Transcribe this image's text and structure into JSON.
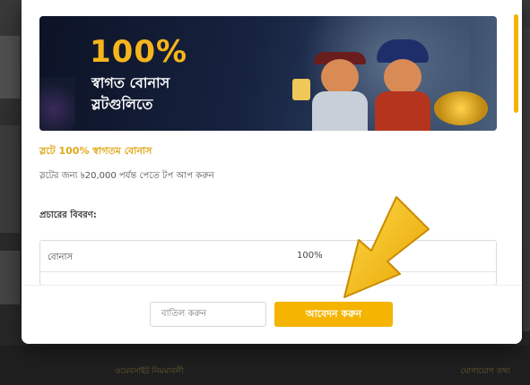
{
  "banner": {
    "headline": "100%",
    "line1": "স্বাগত বোনাস",
    "line2": "স্লটগুলিতে"
  },
  "offer": {
    "title": "স্লটে 100% স্বাগতম বোনাস",
    "description": "স্লটের জন্য ৳20,000 পর্যন্ত পেতে টপ আপ করুন"
  },
  "details_label": "প্রচারের বিবরণ:",
  "details_table": {
    "rows": [
      {
        "label": "বোনাস",
        "value": "100%"
      }
    ]
  },
  "actions": {
    "cancel_label": "বাতিল করুন",
    "apply_label": "আবেদন করুন"
  },
  "background": {
    "footer_left": "ওয়েবসাইট নিয়মাবলী",
    "footer_right": "যোগাযোগ তথ্য"
  },
  "colors": {
    "accent": "#f4b400",
    "offer_title": "#e0a81a",
    "banner_bg": "#16223f"
  },
  "icons": {
    "pointer": "arrow-pointer-icon"
  }
}
